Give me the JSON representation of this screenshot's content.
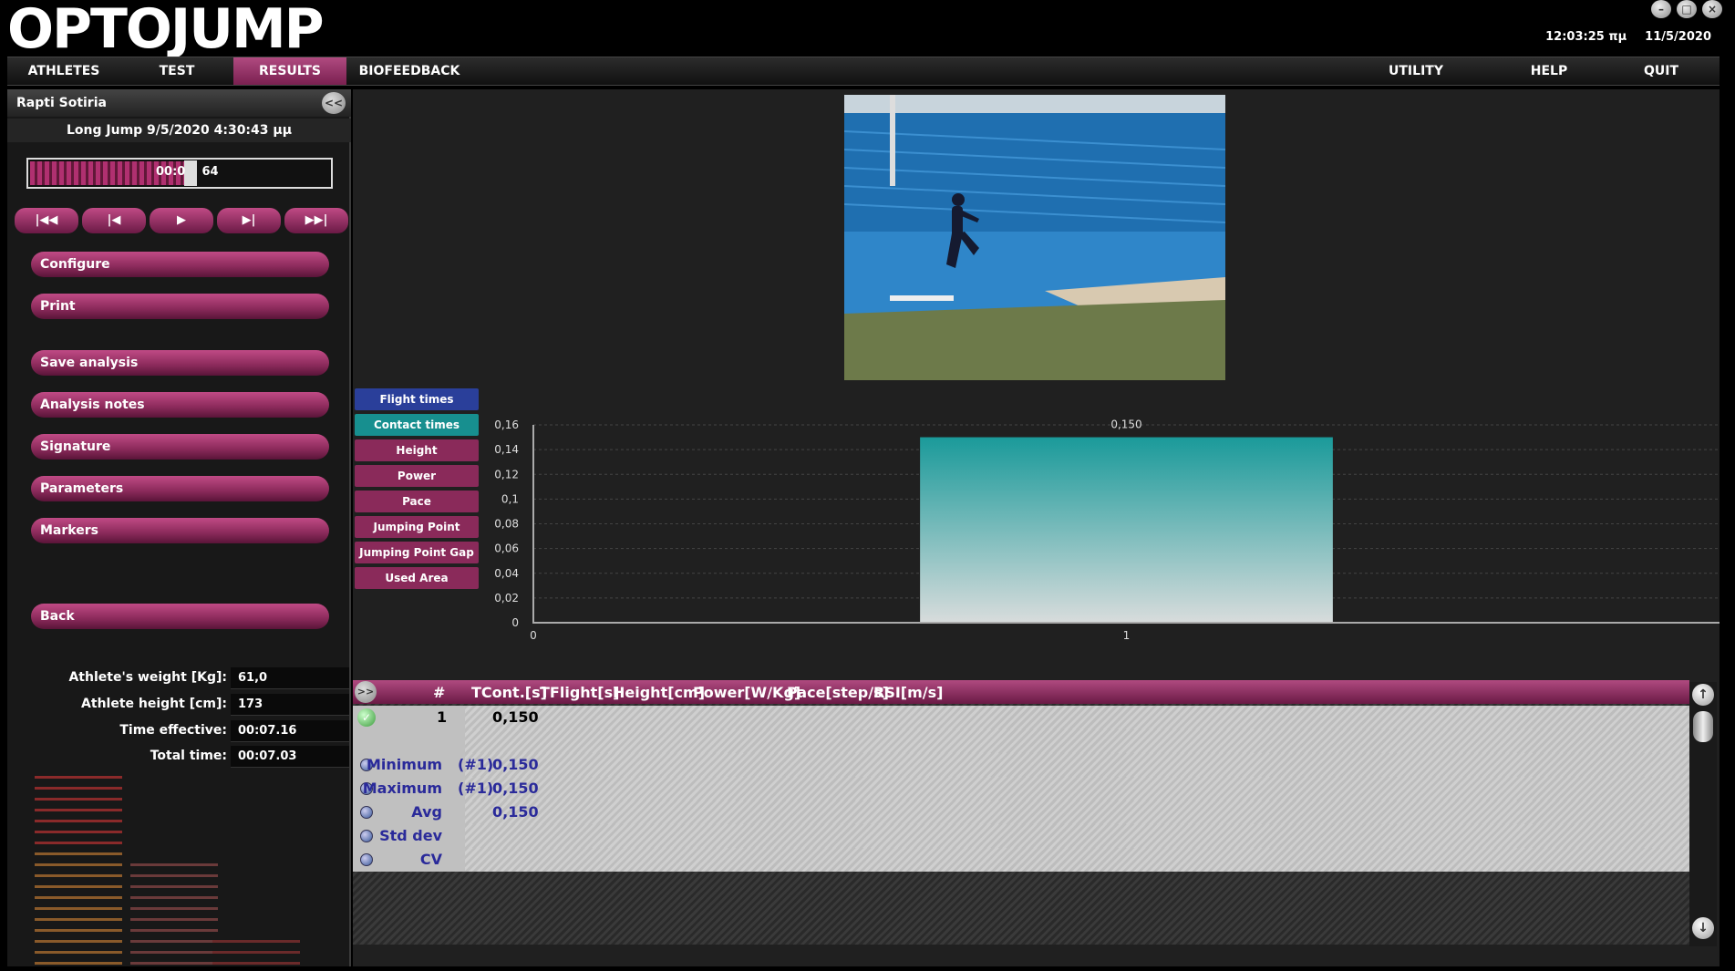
{
  "app": {
    "logo_text": "OPTOJUMP",
    "time": "12:03:25 πμ",
    "date": "11/5/2020"
  },
  "menu": {
    "tabs": [
      "ATHLETES",
      "TEST",
      "RESULTS",
      "BIOFEEDBACK"
    ],
    "right": [
      "UTILITY",
      "HELP",
      "QUIT"
    ],
    "active": "RESULTS"
  },
  "sidebar": {
    "athlete_name": "Rapti Sotiria",
    "collapse_label": "<<",
    "test_title": "Long Jump 9/5/2020 4:30:43 μμ",
    "timeline_time": "00:0    64",
    "timeline_progress": 0.52,
    "playback": [
      "|◀◀",
      "|◀",
      "▶",
      "▶|",
      "▶▶|"
    ],
    "buttons": {
      "configure": "Configure",
      "print": "Print",
      "save": "Save analysis",
      "notes": "Analysis notes",
      "signature": "Signature",
      "parameters": "Parameters",
      "markers": "Markers",
      "back": "Back"
    },
    "info": {
      "weight_label": "Athlete's weight [Kg]:",
      "weight": "61,0",
      "height_label": "Athlete height [cm]:",
      "height": "173",
      "time_eff_label": "Time effective:",
      "time_eff": "00:07.16",
      "total_label": "Total time:",
      "total": "00:07.03"
    }
  },
  "metric_buttons": [
    {
      "label": "Flight times",
      "color": "#2a3f9a"
    },
    {
      "label": "Contact times",
      "color": "#178f8f"
    },
    {
      "label": "Height",
      "color": "#8a2a5a"
    },
    {
      "label": "Power",
      "color": "#8a2a5a"
    },
    {
      "label": "Pace",
      "color": "#8a2a5a"
    },
    {
      "label": "Jumping Point",
      "color": "#8a2a5a"
    },
    {
      "label": "Jumping Point Gap",
      "color": "#8a2a5a"
    },
    {
      "label": "Used Area",
      "color": "#8a2a5a"
    }
  ],
  "chart_data": {
    "type": "bar",
    "categories": [
      "1"
    ],
    "values": [
      0.15
    ],
    "data_labels": [
      "0,150"
    ],
    "x_ticks": [
      "0",
      "1"
    ],
    "y_ticks": [
      "0",
      "0,02",
      "0,04",
      "0,06",
      "0,08",
      "0,1",
      "0,12",
      "0,14",
      "0,16"
    ],
    "ylim": [
      0,
      0.16
    ],
    "xlim": [
      0,
      2
    ],
    "grid": true,
    "bar_color_top": "#1a9a9a",
    "bar_color_bottom": "#d8dcdc"
  },
  "table": {
    "expand_label": ">>",
    "headers": [
      "#",
      "TCont.[s]",
      "TFlight[s]",
      "Height[cm]",
      "Power[W/Kg]",
      "Pace[step/s]",
      "RSI[m/s]"
    ],
    "rows": [
      {
        "num": "1",
        "tcont": "0,150"
      }
    ],
    "stats": [
      {
        "label": "Minimum",
        "ref": "(#1)",
        "value": "0,150"
      },
      {
        "label": "Maximum",
        "ref": "(#1)",
        "value": "0,150"
      },
      {
        "label": "Avg",
        "ref": "",
        "value": "0,150"
      },
      {
        "label": "Std dev",
        "ref": "",
        "value": ""
      },
      {
        "label": "CV",
        "ref": "",
        "value": ""
      }
    ]
  }
}
